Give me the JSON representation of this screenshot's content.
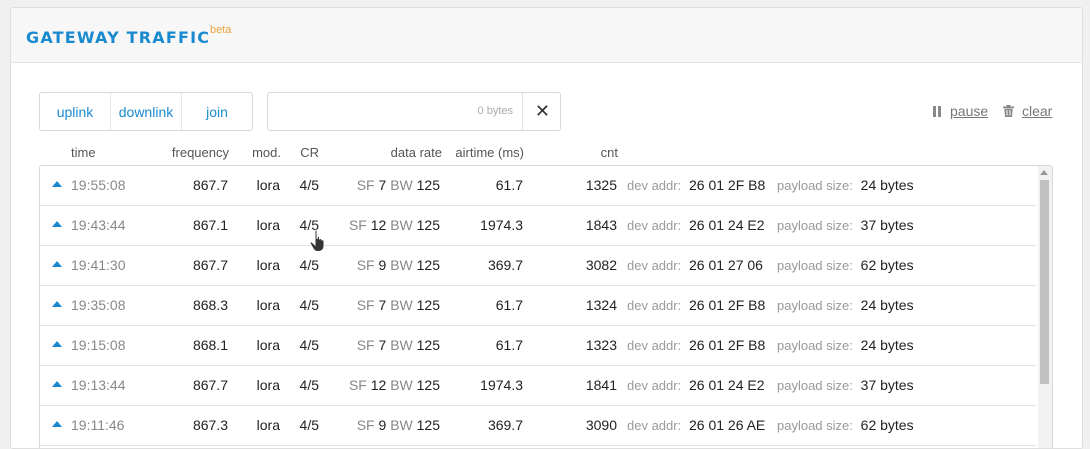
{
  "header": {
    "title": "GATEWAY TRAFFIC",
    "badge": "beta"
  },
  "filters": [
    {
      "label": "uplink"
    },
    {
      "label": "downlink"
    },
    {
      "label": "join"
    }
  ],
  "search": {
    "bytes_label": "0 bytes",
    "clear_glyph": "✕"
  },
  "actions": {
    "pause_label": "pause",
    "clear_label": "clear"
  },
  "columns": {
    "time": "time",
    "frequency": "frequency",
    "mod": "mod.",
    "cr": "CR",
    "data_rate": "data rate",
    "airtime": "airtime (ms)",
    "cnt": "cnt"
  },
  "field_labels": {
    "sf": "SF",
    "bw": "BW",
    "dev_addr": "dev addr:",
    "payload": "payload size:"
  },
  "rows": [
    {
      "time": "19:55:08",
      "frequency": "867.7",
      "mod": "lora",
      "cr": "4/5",
      "sf": "7",
      "bw": "125",
      "airtime": "61.7",
      "cnt": "1325",
      "dev_addr": "26 01 2F B8",
      "payload": "24 bytes"
    },
    {
      "time": "19:43:44",
      "frequency": "867.1",
      "mod": "lora",
      "cr": "4/5",
      "sf": "12",
      "bw": "125",
      "airtime": "1974.3",
      "cnt": "1843",
      "dev_addr": "26 01 24 E2",
      "payload": "37 bytes"
    },
    {
      "time": "19:41:30",
      "frequency": "867.7",
      "mod": "lora",
      "cr": "4/5",
      "sf": "9",
      "bw": "125",
      "airtime": "369.7",
      "cnt": "3082",
      "dev_addr": "26 01 27 06",
      "payload": "62 bytes"
    },
    {
      "time": "19:35:08",
      "frequency": "868.3",
      "mod": "lora",
      "cr": "4/5",
      "sf": "7",
      "bw": "125",
      "airtime": "61.7",
      "cnt": "1324",
      "dev_addr": "26 01 2F B8",
      "payload": "24 bytes"
    },
    {
      "time": "19:15:08",
      "frequency": "868.1",
      "mod": "lora",
      "cr": "4/5",
      "sf": "7",
      "bw": "125",
      "airtime": "61.7",
      "cnt": "1323",
      "dev_addr": "26 01 2F B8",
      "payload": "24 bytes"
    },
    {
      "time": "19:13:44",
      "frequency": "867.7",
      "mod": "lora",
      "cr": "4/5",
      "sf": "12",
      "bw": "125",
      "airtime": "1974.3",
      "cnt": "1841",
      "dev_addr": "26 01 24 E2",
      "payload": "37 bytes"
    },
    {
      "time": "19:11:46",
      "frequency": "867.3",
      "mod": "lora",
      "cr": "4/5",
      "sf": "9",
      "bw": "125",
      "airtime": "369.7",
      "cnt": "3090",
      "dev_addr": "26 01 26 AE",
      "payload": "62 bytes"
    }
  ],
  "icons": {
    "direction": "uplink-arrow-icon",
    "pause": "pause-icon",
    "clear": "trash-icon"
  },
  "colors": {
    "accent": "#1a8ad0",
    "badge": "#e8a33d"
  }
}
